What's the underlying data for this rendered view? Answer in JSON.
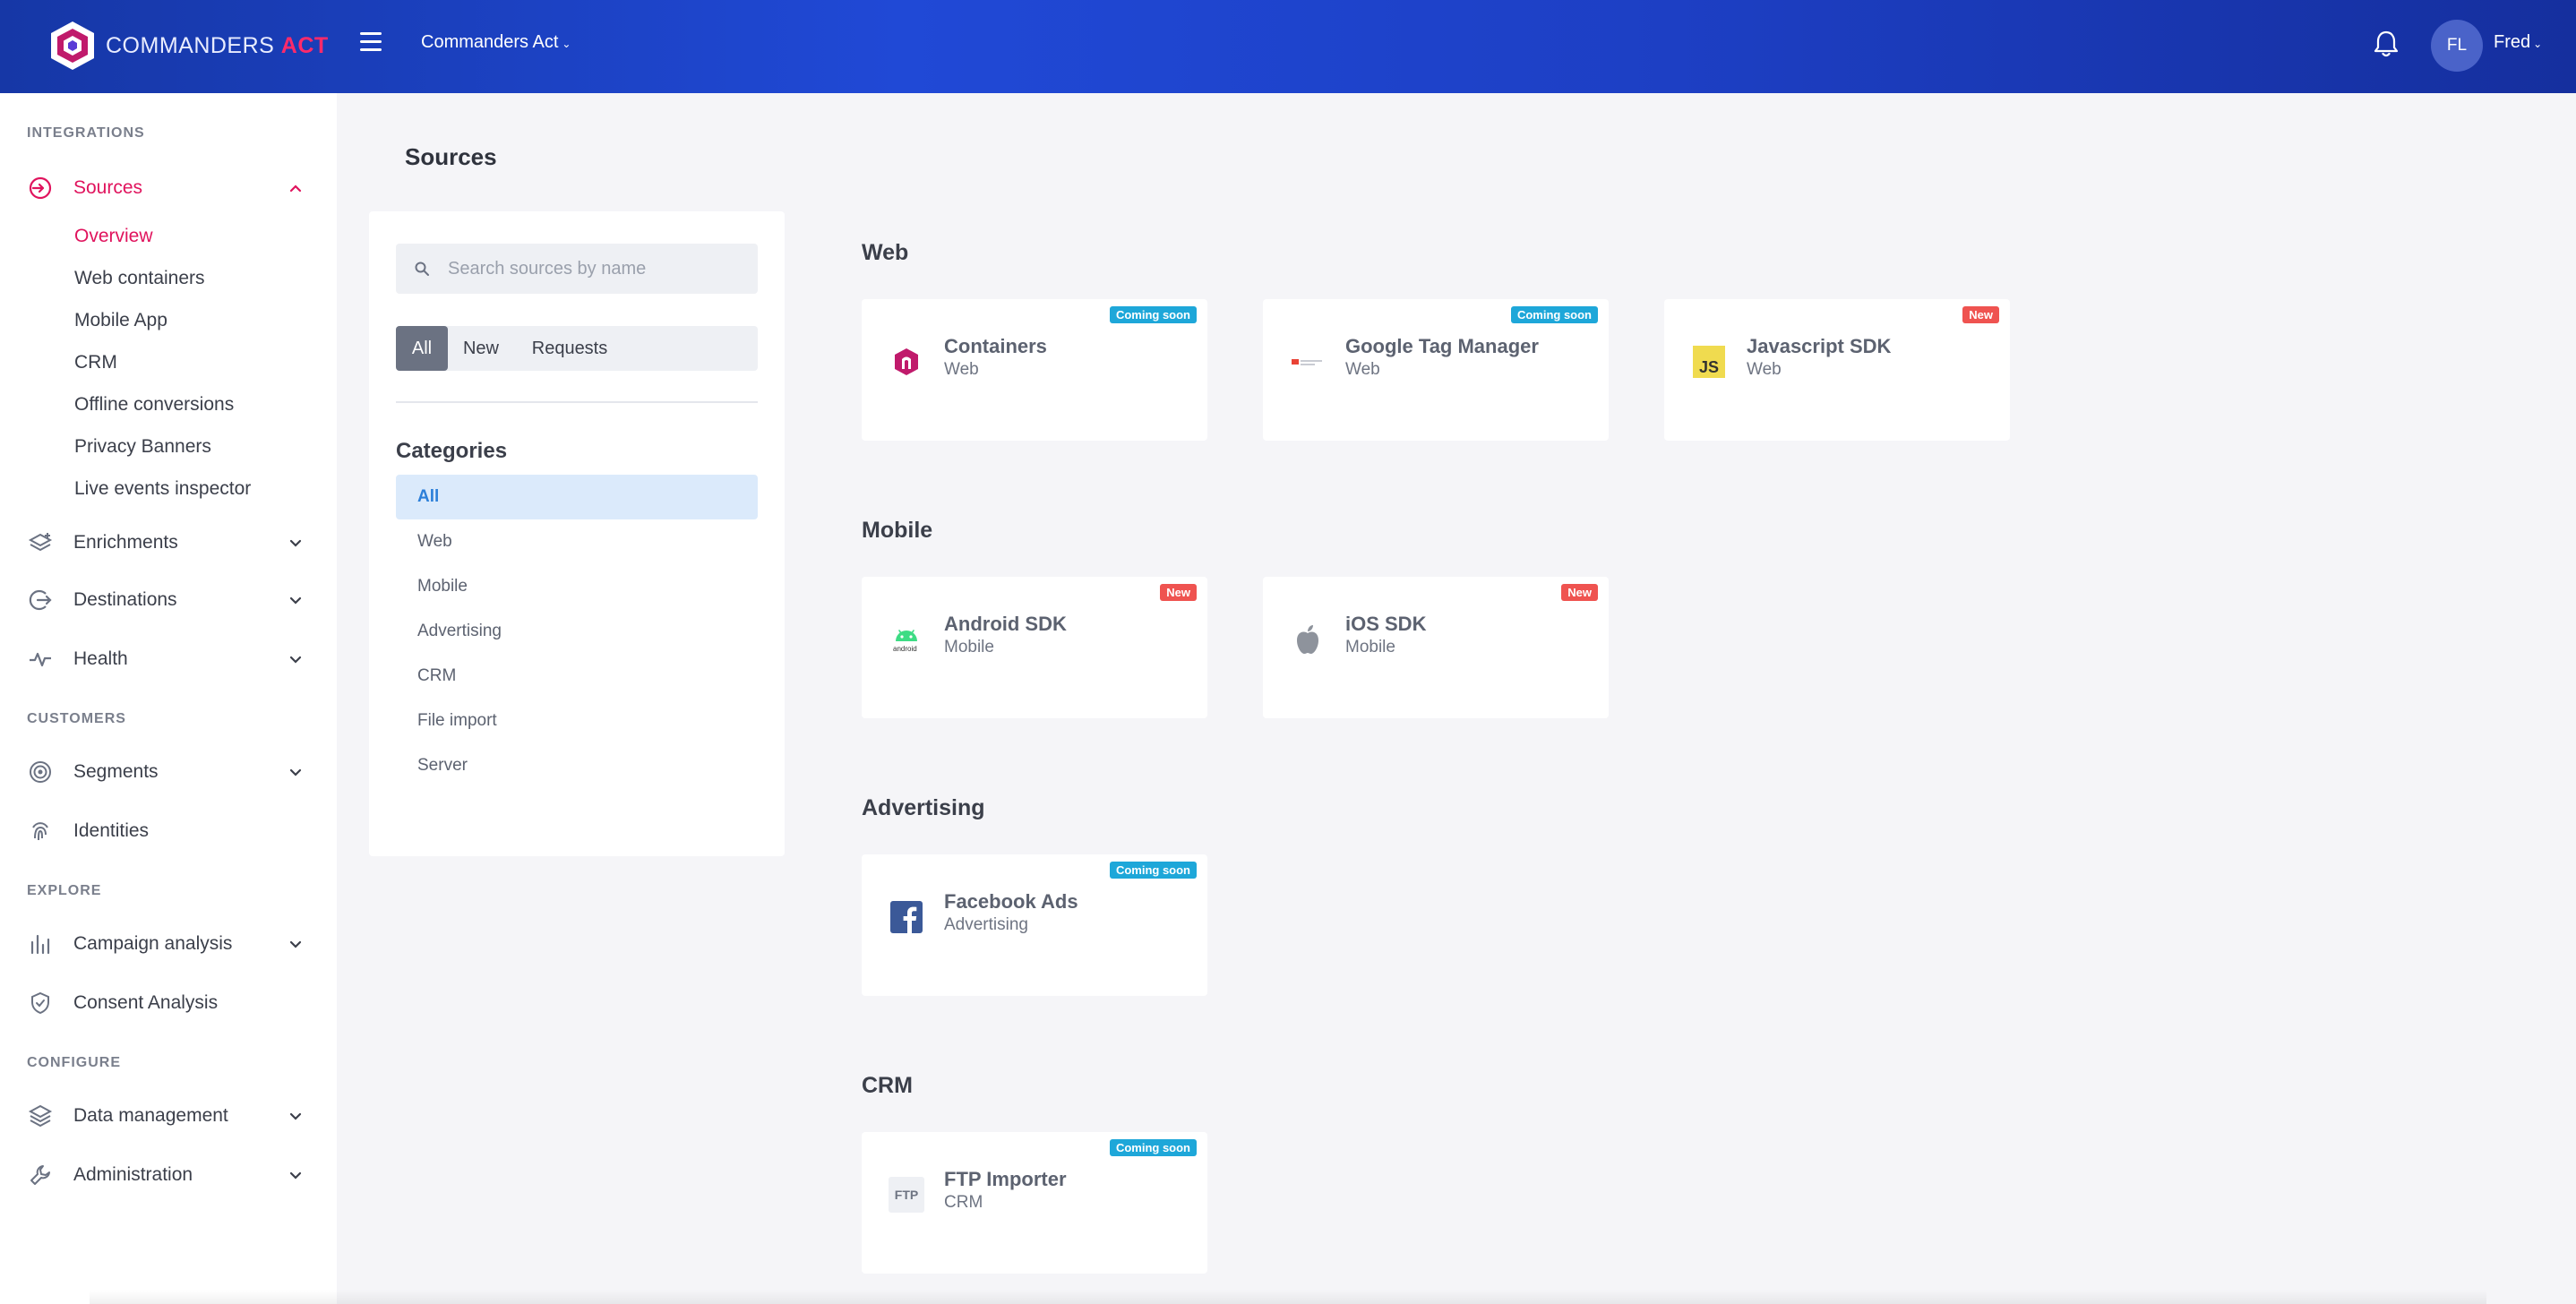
{
  "header": {
    "logo_text_1": "COMMANDERS",
    "logo_text_2": "ACT",
    "org_name": "Commanders Act",
    "avatar_initials": "FL",
    "user_name": "Fred"
  },
  "sidebar": {
    "sections": [
      {
        "title": "INTEGRATIONS"
      },
      {
        "title": "CUSTOMERS"
      },
      {
        "title": "EXPLORE"
      },
      {
        "title": "CONFIGURE"
      }
    ],
    "items": {
      "sources": "Sources",
      "enrichments": "Enrichments",
      "destinations": "Destinations",
      "health": "Health",
      "segments": "Segments",
      "identities": "Identities",
      "campaign_analysis": "Campaign analysis",
      "consent_analysis": "Consent Analysis",
      "data_management": "Data management",
      "administration": "Administration"
    },
    "sources_sub": [
      "Overview",
      "Web containers",
      "Mobile App",
      "CRM",
      "Offline conversions",
      "Privacy Banners",
      "Live events inspector"
    ]
  },
  "page": {
    "title": "Sources"
  },
  "filter": {
    "search_placeholder": "Search sources by name",
    "tabs": [
      "All",
      "New",
      "Requests"
    ],
    "active_tab": "All",
    "categories_title": "Categories",
    "categories": [
      "All",
      "Web",
      "Mobile",
      "Advertising",
      "CRM",
      "File import",
      "Server"
    ],
    "active_category": "All"
  },
  "sections": {
    "web": {
      "heading": "Web",
      "cards": [
        {
          "title": "Containers",
          "sub": "Web",
          "badge": "Coming soon",
          "icon": "commanders-act-logo-icon"
        },
        {
          "title": "Google Tag Manager",
          "sub": "Web",
          "badge": "Coming soon",
          "icon": "google-tag-manager-icon"
        },
        {
          "title": "Javascript SDK",
          "sub": "Web",
          "badge": "New",
          "icon": "javascript-icon"
        }
      ]
    },
    "mobile": {
      "heading": "Mobile",
      "cards": [
        {
          "title": "Android SDK",
          "sub": "Mobile",
          "badge": "New",
          "icon": "android-icon"
        },
        {
          "title": "iOS SDK",
          "sub": "Mobile",
          "badge": "New",
          "icon": "apple-icon"
        }
      ]
    },
    "advertising": {
      "heading": "Advertising",
      "cards": [
        {
          "title": "Facebook Ads",
          "sub": "Advertising",
          "badge": "Coming soon",
          "icon": "facebook-icon"
        }
      ]
    },
    "crm": {
      "heading": "CRM",
      "cards": [
        {
          "title": "FTP Importer",
          "sub": "CRM",
          "badge": "Coming soon",
          "icon": "ftp-icon",
          "icon_text": "FTP"
        }
      ]
    }
  },
  "colors": {
    "accent": "#e0135d",
    "header_blue": "#2049d6",
    "badge_soon": "#1ea7d9",
    "badge_new": "#ef5350",
    "category_active_bg": "#dbeafb"
  }
}
